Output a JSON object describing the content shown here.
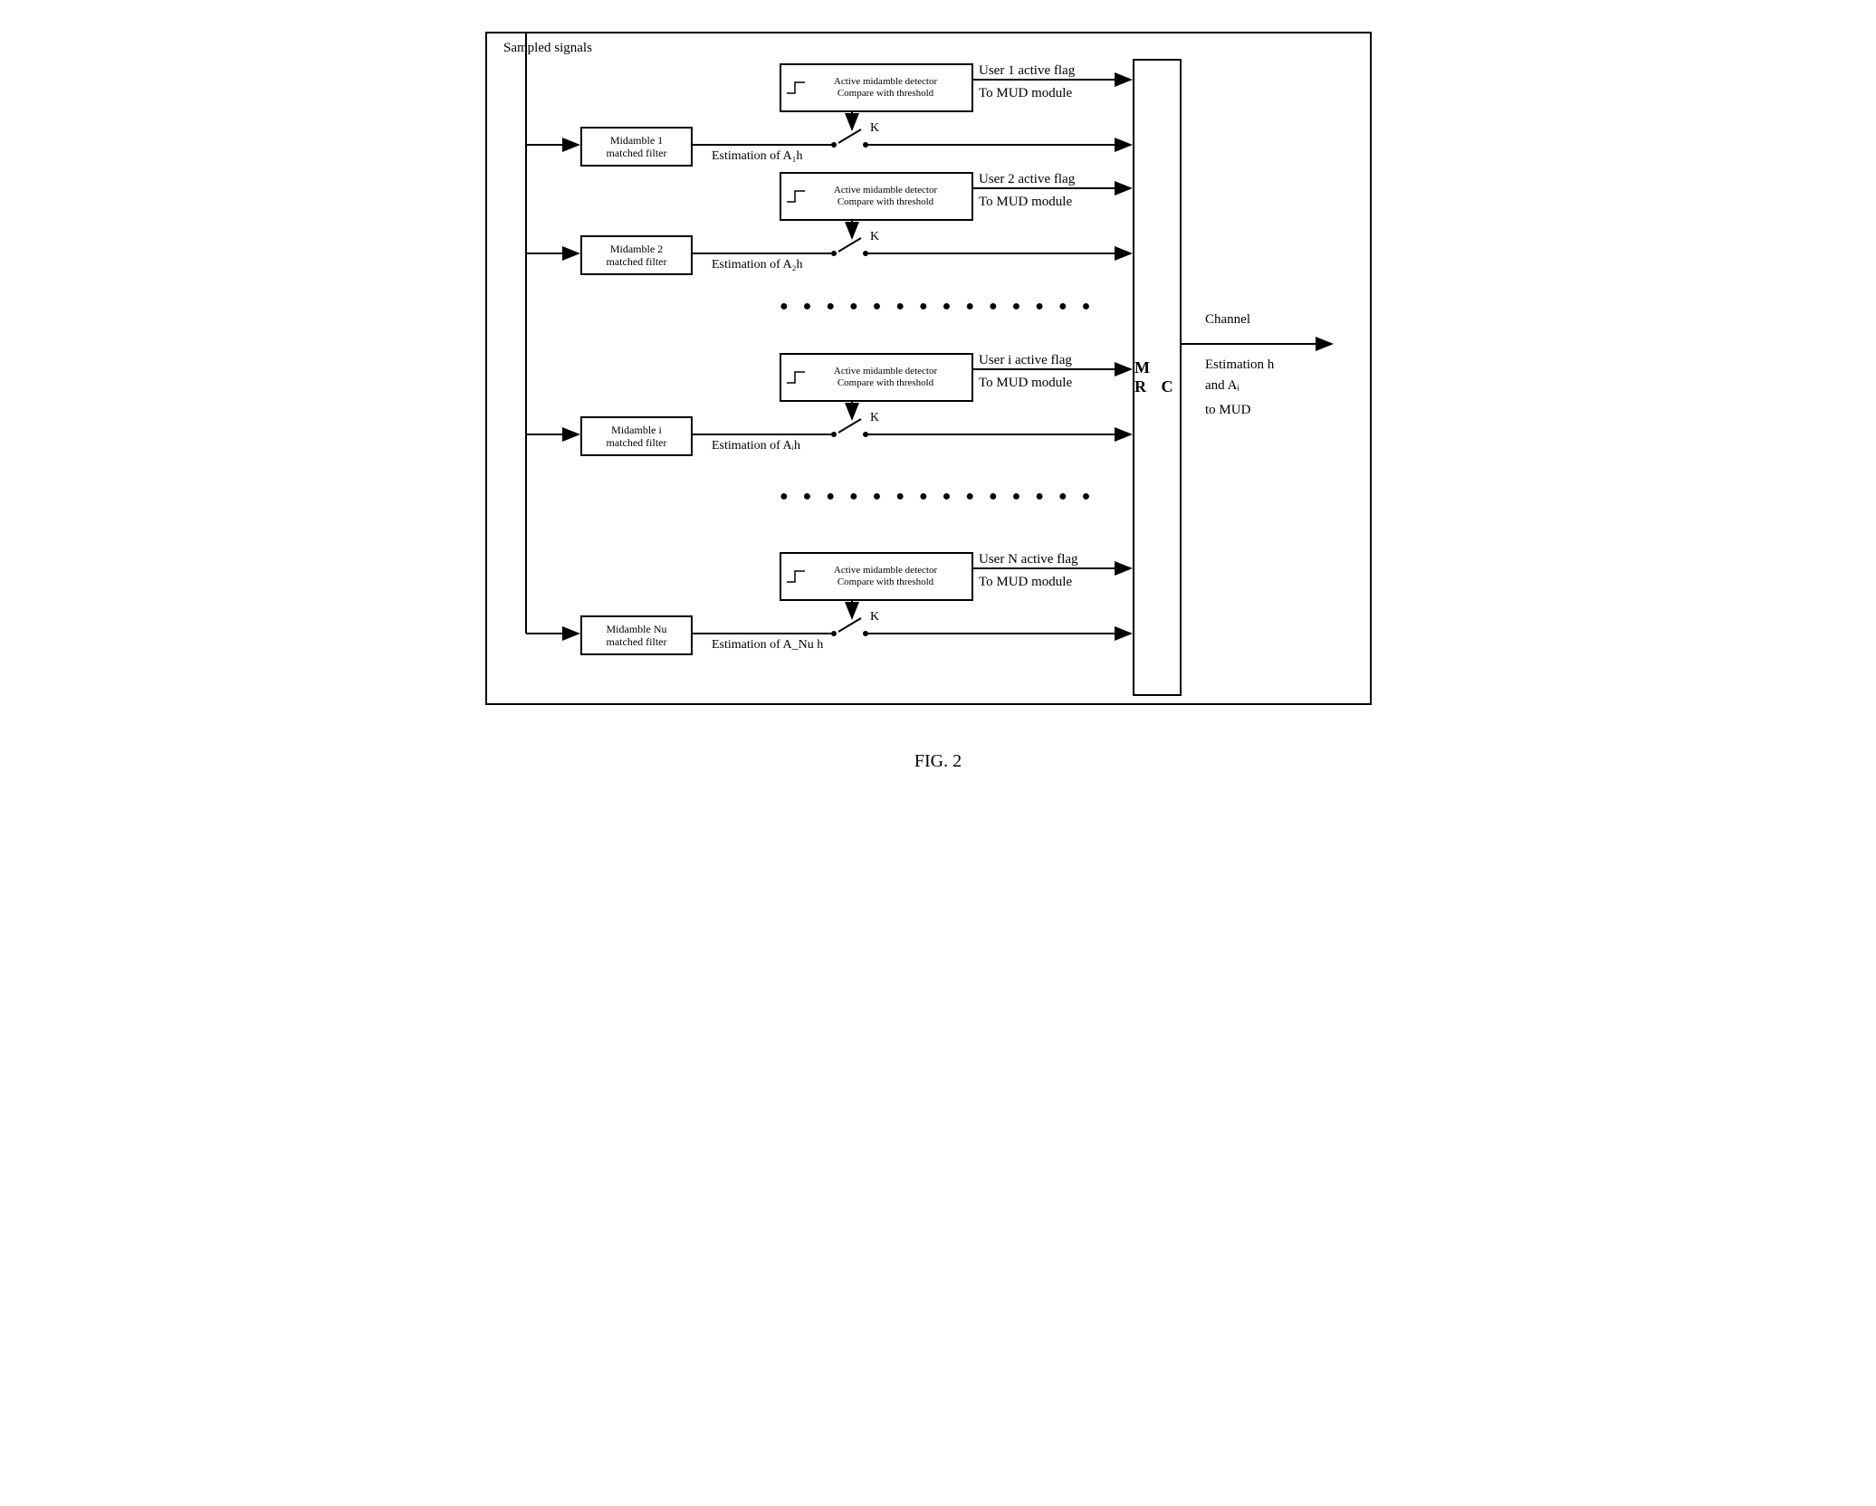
{
  "input_label": "Sampled signals",
  "filters": [
    "Midamble 1\nmatched filter",
    "Midamble 2\nmatched filter",
    "Midamble i\nmatched filter",
    "Midamble Nu\nmatched filter"
  ],
  "detector_line1": "Active midamble detector",
  "detector_line2": "Compare with threshold",
  "switch_label": "K",
  "estimations": [
    "Estimation of A₁h",
    "Estimation of A₂h",
    "Estimation of Aᵢh",
    "Estimation of A_Nu h"
  ],
  "user_flags": [
    "User 1 active flag",
    "User 2 active flag",
    "User i active flag",
    "User N active flag"
  ],
  "to_mud": "To MUD module",
  "mrc_label": "M R C",
  "output_1": "Channel",
  "output_2": "Estimation h",
  "output_3": "and Aᵢ",
  "output_4": "to MUD",
  "ellipsis": "● ● ● ● ● ● ● ● ● ● ● ● ● ●",
  "figure_label": "FIG. 2"
}
